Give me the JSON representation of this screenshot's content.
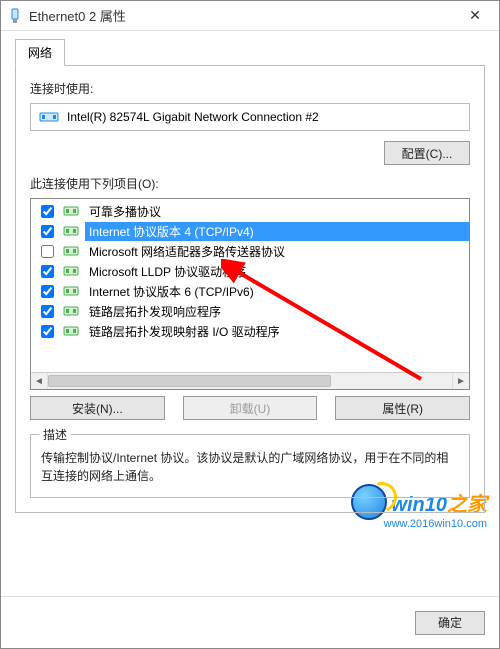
{
  "window": {
    "title": "Ethernet0 2 属性",
    "close_glyph": "✕"
  },
  "tab": {
    "label": "网络"
  },
  "connect_using": {
    "label": "连接时使用:",
    "device": "Intel(R) 82574L Gigabit Network Connection #2"
  },
  "configure_btn": "配置(C)...",
  "items_label": "此连接使用下列项目(O):",
  "items": [
    {
      "checked": true,
      "label": "可靠多播协议"
    },
    {
      "checked": true,
      "label": "Internet 协议版本 4 (TCP/IPv4)",
      "selected": true
    },
    {
      "checked": false,
      "label": "Microsoft 网络适配器多路传送器协议"
    },
    {
      "checked": true,
      "label": "Microsoft LLDP 协议驱动程序"
    },
    {
      "checked": true,
      "label": "Internet 协议版本 6 (TCP/IPv6)"
    },
    {
      "checked": true,
      "label": "链路层拓扑发现响应程序"
    },
    {
      "checked": true,
      "label": "链路层拓扑发现映射器 I/O 驱动程序"
    }
  ],
  "buttons": {
    "install": "安装(N)...",
    "uninstall": "卸载(U)",
    "properties": "属性(R)"
  },
  "description": {
    "title": "描述",
    "text": "传输控制协议/Internet 协议。该协议是默认的广域网络协议，用于在不同的相互连接的网络上通信。"
  },
  "footer": {
    "ok": "确定"
  },
  "watermark": {
    "brand_prefix": "win10",
    "brand_suffix": "之家",
    "url": "www.2016win10.com"
  },
  "icons": {
    "app": "network-adapter-icon",
    "nic": "nic-icon",
    "proto": "protocol-icon"
  }
}
